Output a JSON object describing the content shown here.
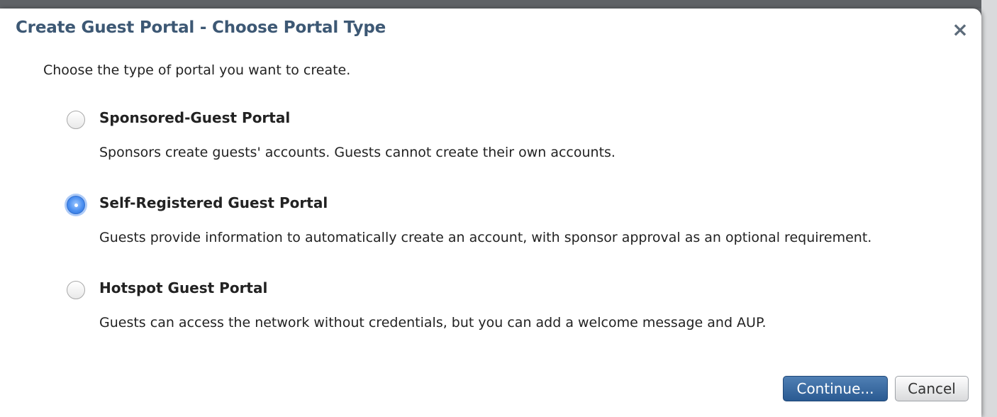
{
  "dialog": {
    "title": "Create Guest Portal - Choose Portal Type",
    "close_icon": "close-icon",
    "prompt": "Choose the type of portal you want to create.",
    "options": [
      {
        "label": "Sponsored-Guest Portal",
        "description": "Sponsors create guests' accounts. Guests cannot create their own accounts.",
        "selected": false
      },
      {
        "label": "Self-Registered Guest Portal",
        "description": "Guests provide information to automatically create an account, with sponsor approval as an optional requirement.",
        "selected": true
      },
      {
        "label": "Hotspot Guest Portal",
        "description": "Guests can access the network without credentials, but you can add a welcome message and AUP.",
        "selected": false
      }
    ],
    "buttons": {
      "continue_label": "Continue...",
      "cancel_label": "Cancel"
    }
  },
  "colors": {
    "title": "#3d5874",
    "primary_button": "#2a5a92",
    "radio_selected": "#4b8ff0"
  }
}
